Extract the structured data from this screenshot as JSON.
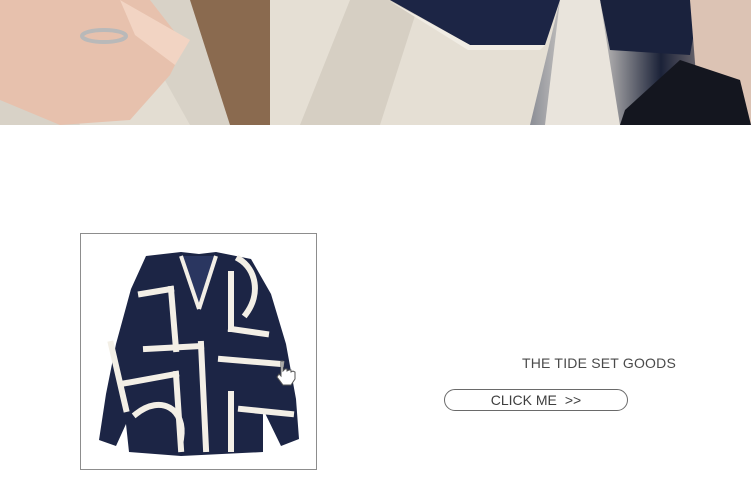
{
  "promo": {
    "tagline": "THE TIDE SET GOODS",
    "cta_label": "CLICK ME",
    "cta_arrow": ">>"
  },
  "icons": {
    "hand": "hand-pointer-icon"
  },
  "colors": {
    "navy": "#1c2545",
    "cream": "#f3efe6",
    "text": "#4a4a4a",
    "border": "#8d8d8d"
  }
}
